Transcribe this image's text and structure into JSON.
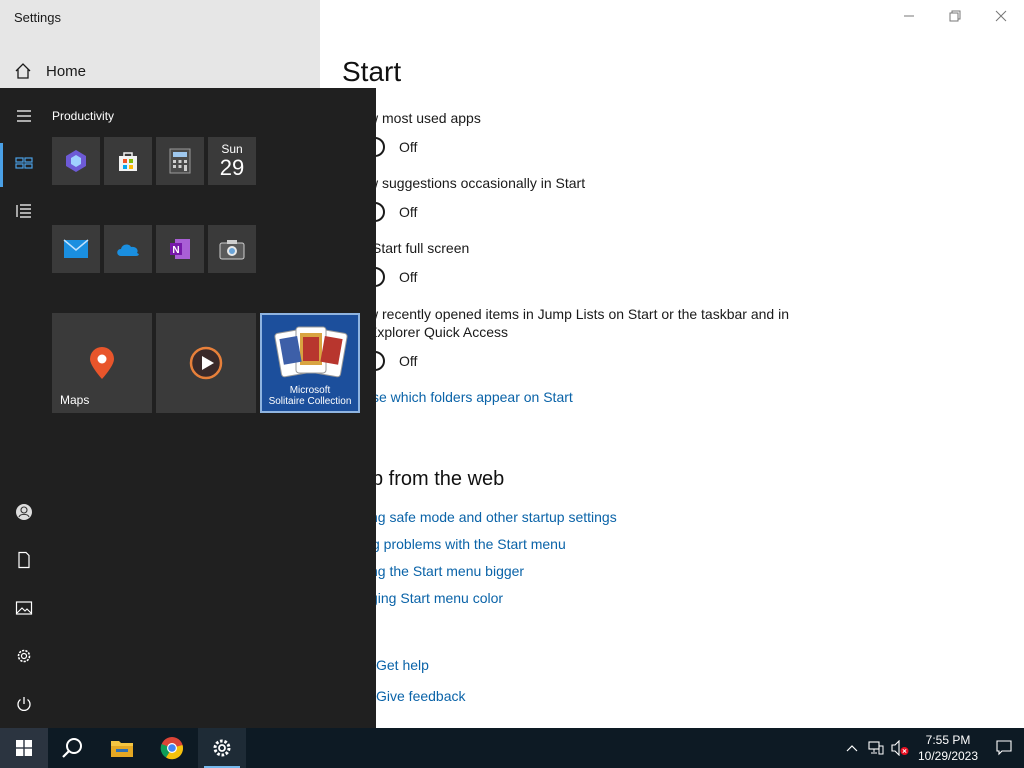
{
  "settings": {
    "window_title": "Settings",
    "home_label": "Home",
    "page_title": "Start",
    "options": [
      {
        "label": "Show most used apps",
        "visible_label": "w most used apps",
        "state": "Off"
      },
      {
        "label": "Show suggestions occasionally in Start",
        "visible_label": "w suggestions occasionally in Start",
        "state": "Off"
      },
      {
        "label": "Use Start full screen",
        "visible_label": "Start full screen",
        "state": "Off"
      },
      {
        "label_line1": "w recently opened items in Jump Lists on Start or the taskbar and in",
        "label_line2": "Explorer Quick Access",
        "state": "Off"
      }
    ],
    "folders_link": "se which folders appear on Start",
    "help_section_title": "p from the web",
    "help_links": [
      "ng safe mode and other startup settings",
      "g problems with the Start menu",
      "ng the Start menu bigger",
      "ging Start menu color"
    ],
    "get_help": "Get help",
    "give_feedback": "Give feedback"
  },
  "start_menu": {
    "group_title": "Productivity",
    "calendar": {
      "day": "Sun",
      "date": "29"
    },
    "tiles": {
      "maps_label": "Maps",
      "solitaire_line1": "Microsoft",
      "solitaire_line2": "Solitaire Collection"
    }
  },
  "taskbar": {
    "time": "7:55 PM",
    "date": "10/29/2023"
  },
  "colors": {
    "accent": "#0a63a8",
    "start_bg": "#202020",
    "taskbar_bg": "#0d1a24"
  }
}
